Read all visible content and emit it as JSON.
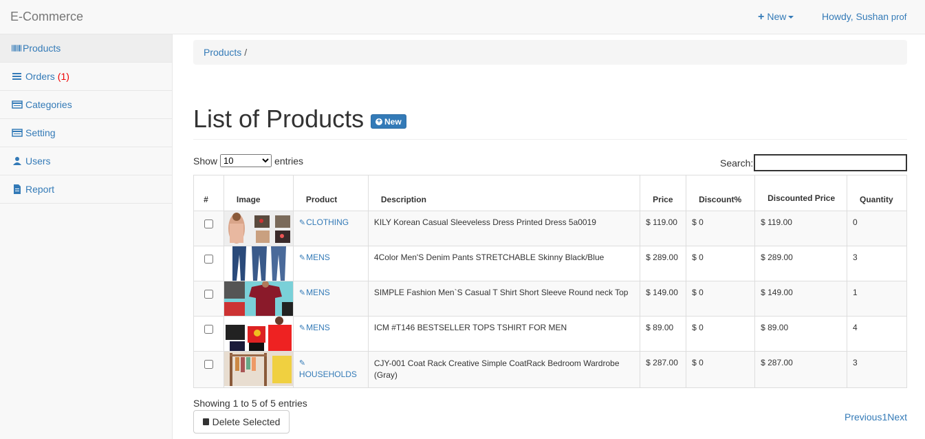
{
  "topbar": {
    "brand": "E-Commerce",
    "new_label": "New",
    "user_greeting": "Howdy, Sushan",
    "user_suffix": "prof"
  },
  "sidebar": {
    "items": [
      {
        "label": "Products",
        "icon": "barcode-icon",
        "active": true
      },
      {
        "label": "Orders",
        "icon": "list-icon",
        "badge": "(1)"
      },
      {
        "label": "Categories",
        "icon": "card-icon"
      },
      {
        "label": "Setting",
        "icon": "settings-card-icon"
      },
      {
        "label": "Users",
        "icon": "user-icon"
      },
      {
        "label": "Report",
        "icon": "file-icon"
      }
    ]
  },
  "breadcrumb": {
    "current": "Products",
    "separator": "/"
  },
  "page": {
    "title": "List of Products",
    "new_button": "New"
  },
  "table_controls": {
    "show_label": "Show",
    "entries_label": "entries",
    "page_size": "10",
    "search_label": "Search:"
  },
  "table": {
    "headers": [
      "#",
      "Image",
      "Product",
      "Description",
      "Price",
      "Discount%",
      "Discounted Price",
      "Quantity"
    ],
    "rows": [
      {
        "category": "CLOTHING",
        "description": "KILY Korean Casual Sleeveless Dress Printed Dress 5a0019",
        "price": "$ 119.00",
        "discount": "$ 0",
        "discounted": "$ 119.00",
        "quantity": "0"
      },
      {
        "category": "MENS",
        "description": "4Color Men'S Denim Pants STRETCHABLE Skinny Black/Blue",
        "price": "$ 289.00",
        "discount": "$ 0",
        "discounted": "$ 289.00",
        "quantity": "3"
      },
      {
        "category": "MENS",
        "description": "SIMPLE Fashion Men`S Casual T Shirt Short Sleeve Round neck Top",
        "price": "$ 149.00",
        "discount": "$ 0",
        "discounted": "$ 149.00",
        "quantity": "1"
      },
      {
        "category": "MENS",
        "description": "ICM #T146 BESTSELLER TOPS TSHIRT FOR MEN",
        "price": "$ 89.00",
        "discount": "$ 0",
        "discounted": "$ 89.00",
        "quantity": "4"
      },
      {
        "category": "HOUSEHOLDS",
        "description": "CJY-001 Coat Rack Creative Simple CoatRack Bedroom Wardrobe (Gray)",
        "price": "$ 287.00",
        "discount": "$ 0",
        "discounted": "$ 287.00",
        "quantity": "3"
      }
    ]
  },
  "footer": {
    "info": "Showing 1 to 5 of 5 entries",
    "delete_button": "Delete Selected",
    "pager_prev": "Previous",
    "pager_page": "1",
    "pager_next": "Next"
  }
}
